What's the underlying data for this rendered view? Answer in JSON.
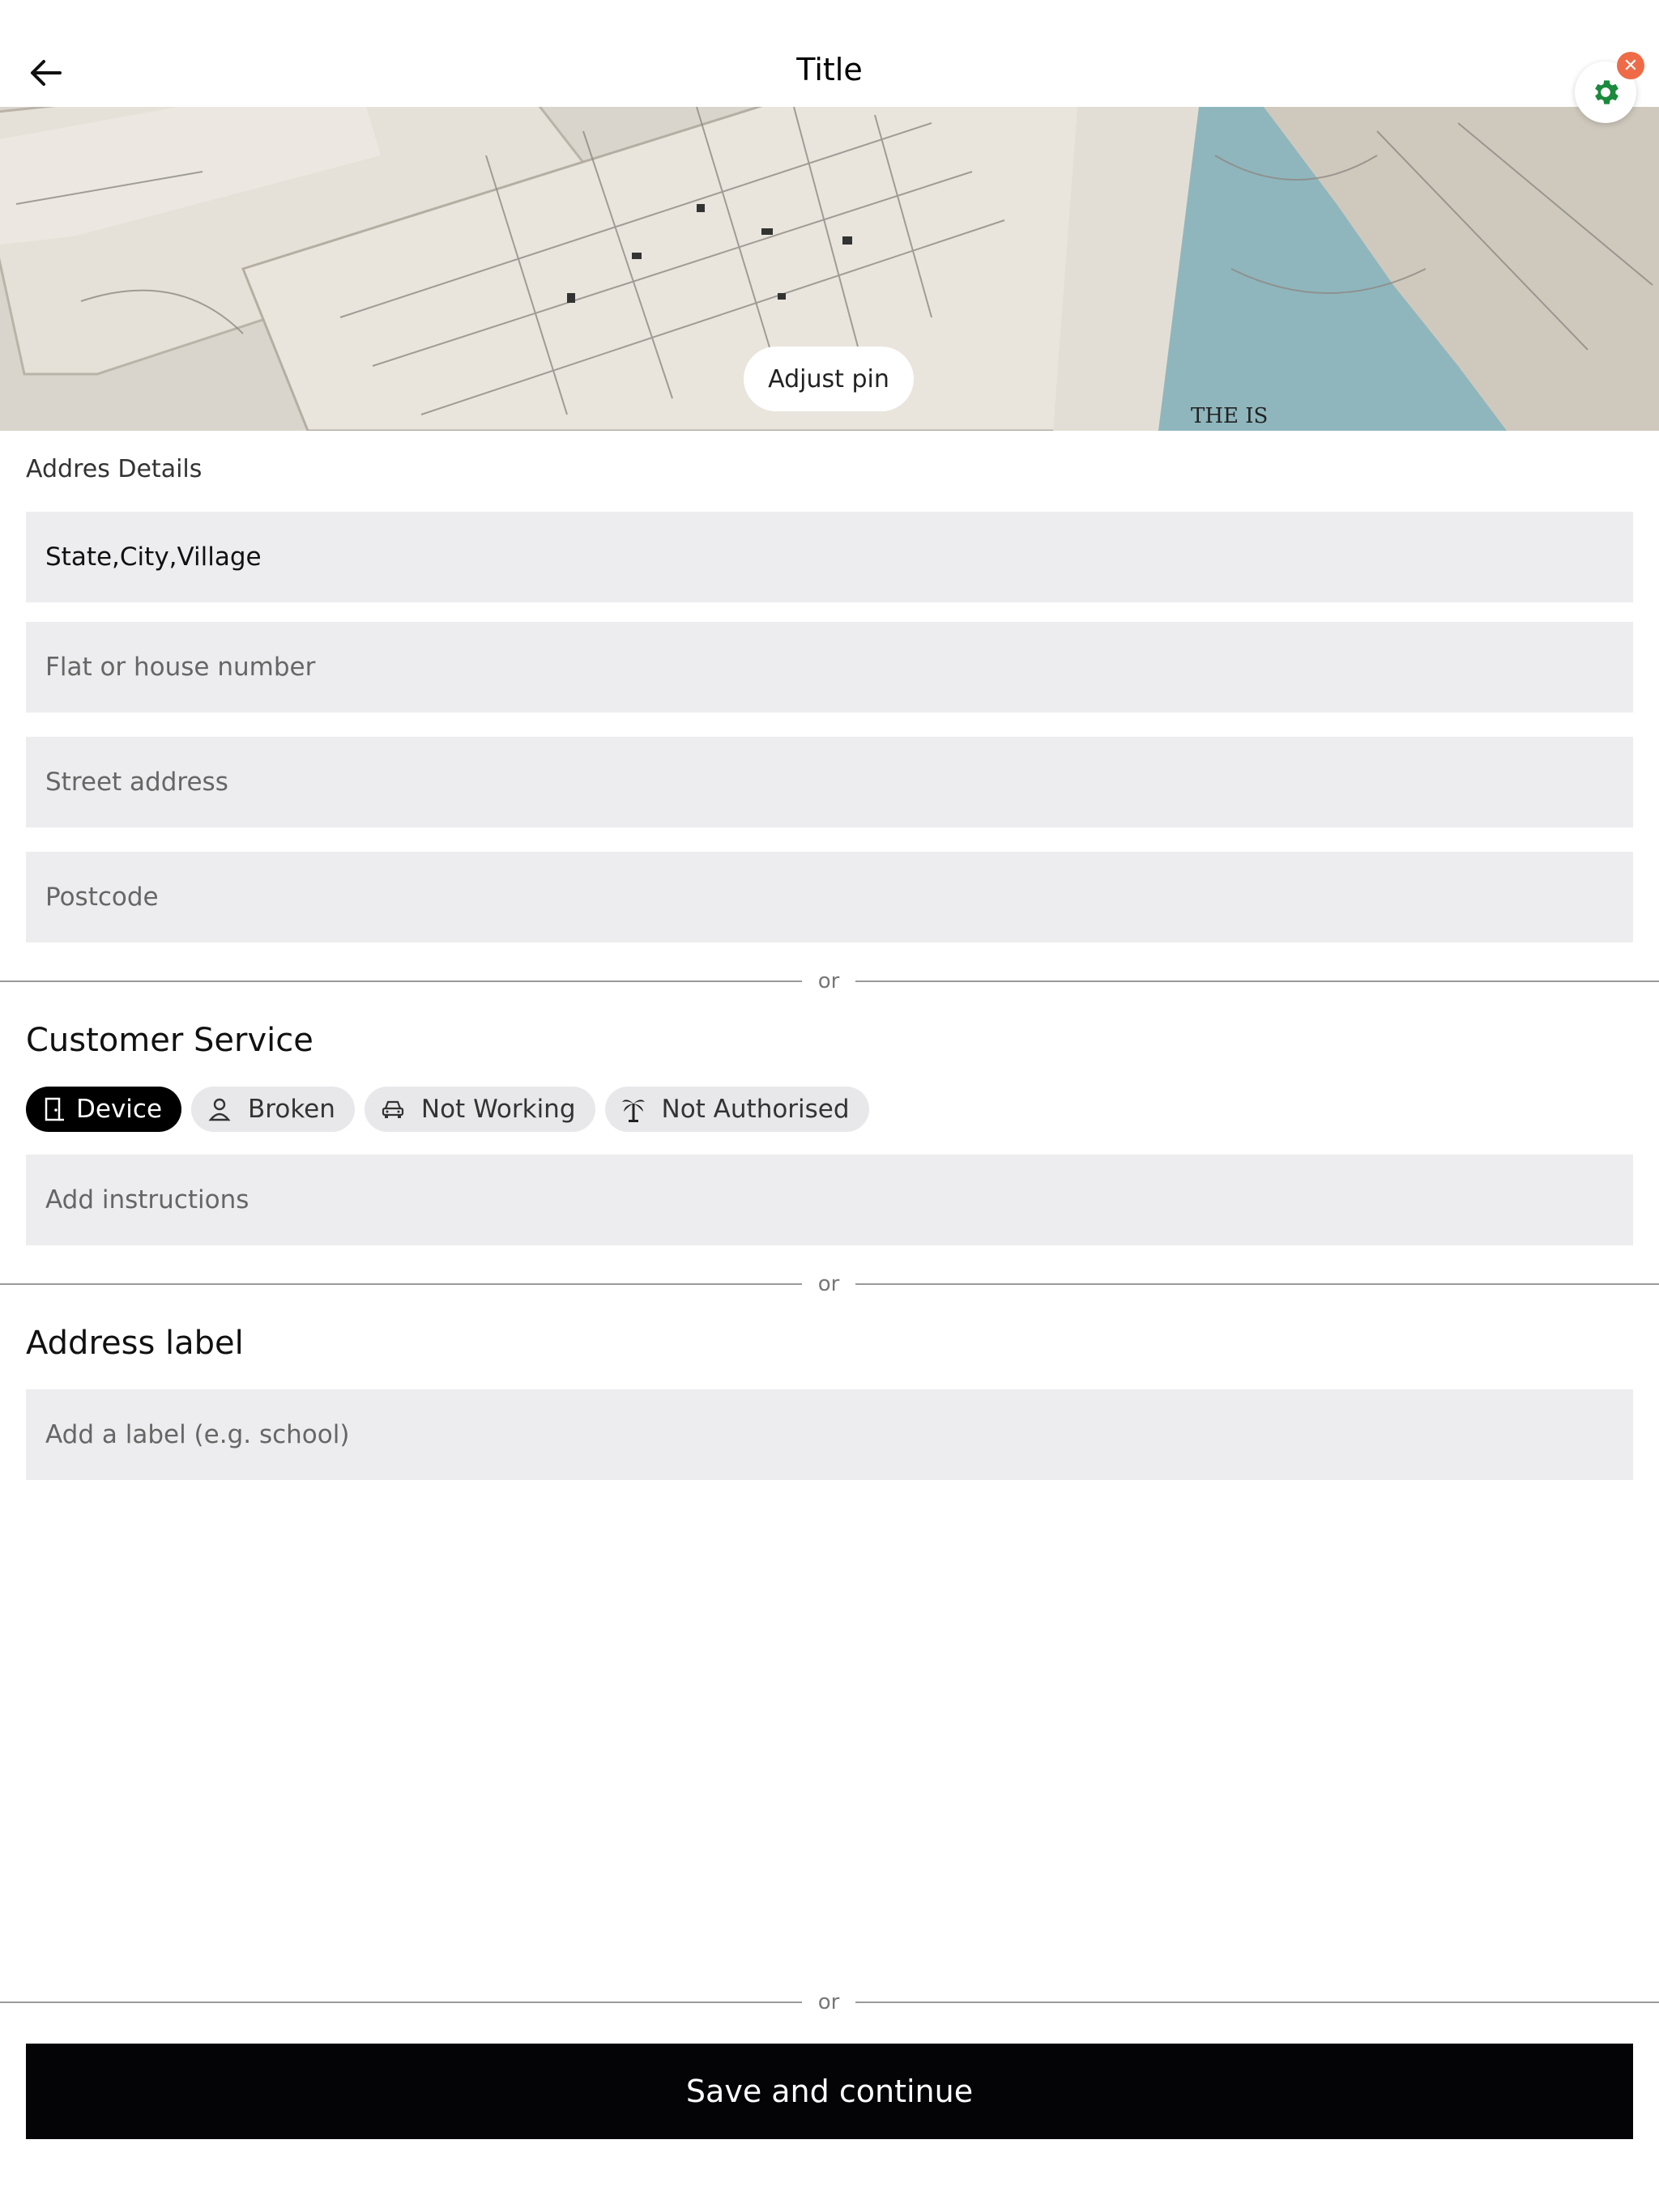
{
  "header": {
    "title": "Title"
  },
  "map": {
    "adjust_pin_label": "Adjust pin"
  },
  "address_details": {
    "caption": "Addres Details",
    "fields": [
      {
        "value": "State,City,Village",
        "placeholder": ""
      },
      {
        "value": "",
        "placeholder": "Flat or house number"
      },
      {
        "value": "",
        "placeholder": "Street address"
      },
      {
        "value": "",
        "placeholder": "Postcode"
      }
    ]
  },
  "divider_label": "or",
  "customer_service": {
    "heading": "Customer Service",
    "chips": [
      {
        "label": "Device",
        "icon": "door-icon",
        "selected": true
      },
      {
        "label": "Broken",
        "icon": "person-icon",
        "selected": false
      },
      {
        "label": "Not Working",
        "icon": "car-icon",
        "selected": false
      },
      {
        "label": "Not Authorised",
        "icon": "palm-tree-icon",
        "selected": false
      }
    ],
    "instructions_placeholder": "Add instructions"
  },
  "address_label": {
    "heading": "Address label",
    "placeholder": "Add a label (e.g. school)"
  },
  "footer": {
    "save_label": "Save and continue"
  },
  "colors": {
    "accent_settings": "#1a8a3c",
    "close_badge": "#ef6b47",
    "field_background": "#edecee",
    "primary_button": "#040407"
  }
}
